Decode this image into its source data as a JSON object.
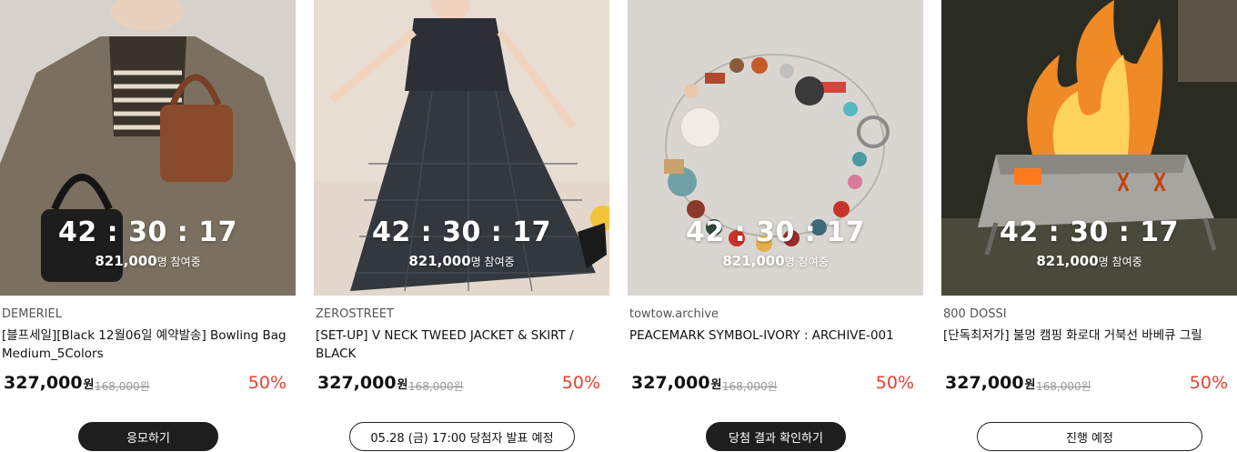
{
  "products": [
    {
      "timer": "42 : 30 : 17",
      "participants_count": "821,000",
      "participants_suffix": "명 참여중",
      "brand": "DEMERIEL",
      "title": "[블프세일][Black 12월06일 예약발송] Bowling Bag Medium_5Colors",
      "price": "327,000",
      "price_unit": "원",
      "original_price": "168,000원",
      "discount": "50%",
      "button_label": "응모하기",
      "button_style": "dark",
      "image_name": "woman-with-bags-image"
    },
    {
      "timer": "42 : 30 : 17",
      "participants_count": "821,000",
      "participants_suffix": "명 참여중",
      "brand": "ZEROSTREET",
      "title": "[SET-UP] V NECK TWEED JACKET & SKIRT / BLACK",
      "price": "327,000",
      "price_unit": "원",
      "original_price": "168,000원",
      "discount": "50%",
      "button_label": "05.28 (금) 17:00 당첨자 발표 예정",
      "button_style": "light",
      "image_name": "tweed-set-model-image"
    },
    {
      "timer": "42 : 30 : 17",
      "participants_count": "821,000",
      "participants_suffix": "명 참여중",
      "brand": "towtow.archive",
      "title": "PEACEMARK SYMBOL-IVORY : ARCHIVE-001",
      "price": "327,000",
      "price_unit": "원",
      "original_price": "168,000원",
      "discount": "50%",
      "button_label": "당첨 결과 확인하기",
      "button_style": "dark",
      "image_name": "beaded-bracelet-image"
    },
    {
      "timer": "42 : 30 : 17",
      "participants_count": "821,000",
      "participants_suffix": "명 참여중",
      "brand": "800 DOSSI",
      "title": "[단독최저가] 불멍 캠핑 화로대 거북선 바베큐 그릴",
      "price": "327,000",
      "price_unit": "원",
      "original_price": "168,000원",
      "discount": "50%",
      "button_label": "진행 예정",
      "button_style": "light",
      "image_name": "camping-fire-grill-image"
    }
  ],
  "colors": {
    "discount": "#e8402f",
    "dark_button": "#1e1e1e"
  }
}
